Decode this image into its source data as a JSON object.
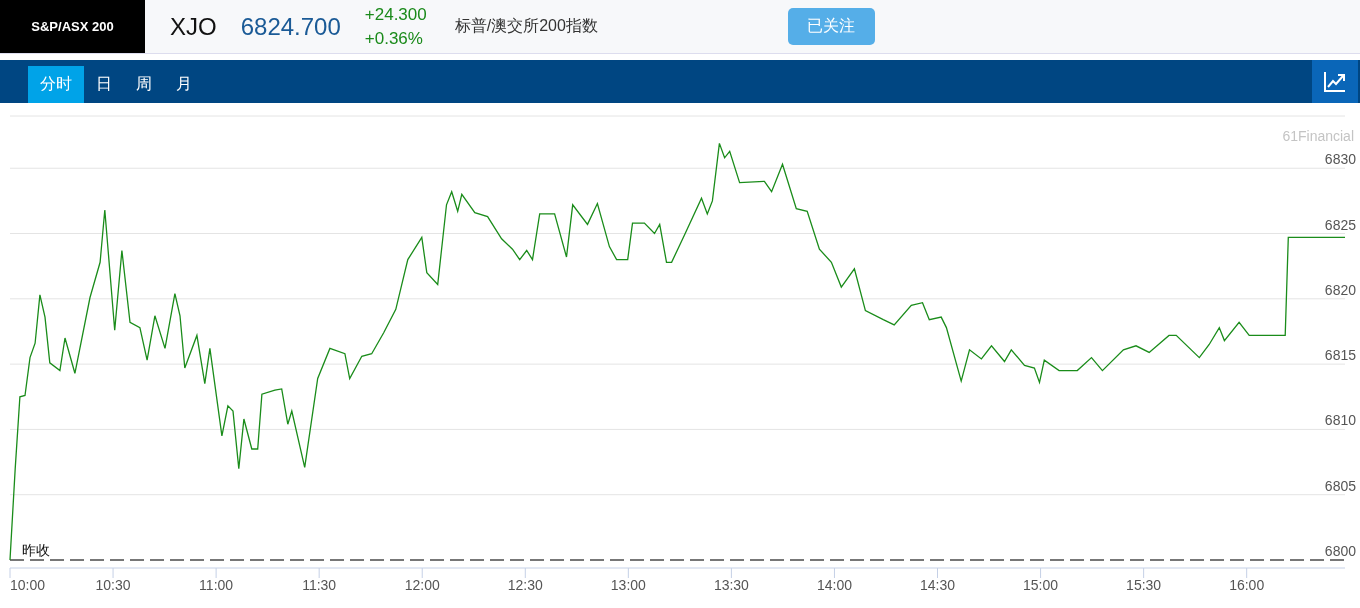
{
  "header": {
    "index_name": "S&P/ASX 200",
    "symbol": "XJO",
    "price": "6824.700",
    "change": "+24.300",
    "change_percent": "+0.36%",
    "description": "标普/澳交所200指数",
    "follow_button": "已关注"
  },
  "tabs": [
    {
      "label": "分时",
      "selected": true
    },
    {
      "label": "日",
      "selected": false
    },
    {
      "label": "周",
      "selected": false
    },
    {
      "label": "月",
      "selected": false
    }
  ],
  "chart": {
    "credits": "61Financial",
    "reference_label": "昨收",
    "chart_data": {
      "type": "line",
      "x": [
        10,
        10.025,
        10.048,
        10.073,
        10.097,
        10.122,
        10.145,
        10.17,
        10.193,
        10.242,
        10.267,
        10.315,
        10.388,
        10.437,
        10.46,
        10.508,
        10.543,
        10.582,
        10.63,
        10.665,
        10.703,
        10.752,
        10.8,
        10.825,
        10.848,
        10.907,
        10.945,
        10.97,
        11.028,
        11.057,
        11.082,
        11.11,
        11.135,
        11.173,
        11.202,
        11.222,
        11.285,
        11.318,
        11.348,
        11.367,
        11.43,
        11.493,
        11.552,
        11.625,
        11.648,
        11.707,
        11.755,
        11.813,
        11.872,
        11.93,
        11.998,
        12.022,
        12.075,
        12.118,
        12.143,
        12.172,
        12.192,
        12.255,
        12.317,
        12.385,
        12.438,
        12.473,
        12.507,
        12.535,
        12.57,
        12.642,
        12.7,
        12.73,
        12.802,
        12.85,
        12.908,
        12.943,
        12.997,
        13.02,
        13.078,
        13.127,
        13.152,
        13.185,
        13.21,
        13.273,
        13.355,
        13.383,
        13.408,
        13.442,
        13.467,
        13.492,
        13.54,
        13.66,
        13.695,
        13.748,
        13.815,
        13.868,
        13.927,
        13.985,
        14.033,
        14.097,
        14.15,
        14.237,
        14.29,
        14.373,
        14.427,
        14.46,
        14.518,
        14.543,
        14.615,
        14.655,
        14.713,
        14.762,
        14.825,
        14.858,
        14.922,
        14.97,
        14.995,
        15.018,
        15.09,
        15.178,
        15.247,
        15.3,
        15.402,
        15.463,
        15.527,
        15.623,
        15.658,
        15.77,
        15.818,
        15.867,
        15.892,
        15.963,
        16.012,
        16.187,
        16.202,
        16.477
      ],
      "series": [
        {
          "color": "#1a8c1a",
          "values": [
            6800.0,
            6807.0,
            6812.5,
            6812.6,
            6815.5,
            6816.6,
            6820.3,
            6818.6,
            6815.1,
            6814.5,
            6817.0,
            6814.3,
            6820.1,
            6822.8,
            6826.8,
            6817.6,
            6823.7,
            6818.2,
            6817.8,
            6815.3,
            6818.7,
            6816.2,
            6820.4,
            6818.7,
            6814.7,
            6817.2,
            6813.5,
            6816.2,
            6809.5,
            6811.8,
            6811.4,
            6807.0,
            6810.8,
            6808.5,
            6808.5,
            6812.7,
            6813.0,
            6813.1,
            6810.4,
            6811.4,
            6807.1,
            6813.9,
            6816.2,
            6815.8,
            6813.9,
            6815.6,
            6815.8,
            6817.4,
            6819.2,
            6823.0,
            6824.7,
            6822.0,
            6821.1,
            6827.2,
            6828.2,
            6826.7,
            6828.0,
            6826.6,
            6826.3,
            6824.6,
            6823.8,
            6823.0,
            6823.7,
            6823.0,
            6826.5,
            6826.5,
            6823.2,
            6827.2,
            6825.7,
            6827.3,
            6824.0,
            6823.0,
            6823.0,
            6825.8,
            6825.8,
            6825.0,
            6825.7,
            6822.8,
            6822.8,
            6824.9,
            6827.7,
            6826.5,
            6827.5,
            6831.9,
            6830.8,
            6831.3,
            6828.9,
            6829.0,
            6828.2,
            6830.3,
            6826.9,
            6826.7,
            6823.8,
            6822.8,
            6820.9,
            6822.3,
            6819.1,
            6818.4,
            6818.0,
            6819.5,
            6819.7,
            6818.4,
            6818.6,
            6817.8,
            6813.7,
            6816.1,
            6815.4,
            6816.4,
            6815.2,
            6816.1,
            6814.9,
            6814.7,
            6813.6,
            6815.3,
            6814.5,
            6814.5,
            6815.5,
            6814.5,
            6816.1,
            6816.4,
            6815.9,
            6817.2,
            6817.2,
            6815.5,
            6816.5,
            6817.8,
            6816.8,
            6818.2,
            6817.2,
            6817.2,
            6824.7,
            6824.7
          ]
        }
      ],
      "grid": true,
      "xlim": [
        10,
        16.477
      ],
      "ylim": [
        6800,
        6834
      ],
      "xticks": [
        {
          "value": 10,
          "label": "10:00"
        },
        {
          "value": 10.5,
          "label": "10:30"
        },
        {
          "value": 11,
          "label": "11:00"
        },
        {
          "value": 11.5,
          "label": "11:30"
        },
        {
          "value": 12,
          "label": "12:00"
        },
        {
          "value": 12.5,
          "label": "12:30"
        },
        {
          "value": 13,
          "label": "13:00"
        },
        {
          "value": 13.5,
          "label": "13:30"
        },
        {
          "value": 14,
          "label": "14:00"
        },
        {
          "value": 14.5,
          "label": "14:30"
        },
        {
          "value": 15,
          "label": "15:00"
        },
        {
          "value": 15.5,
          "label": "15:30"
        },
        {
          "value": 16,
          "label": "16:00"
        }
      ],
      "yticks": [
        6800,
        6805,
        6810,
        6815,
        6820,
        6825,
        6830
      ]
    }
  }
}
